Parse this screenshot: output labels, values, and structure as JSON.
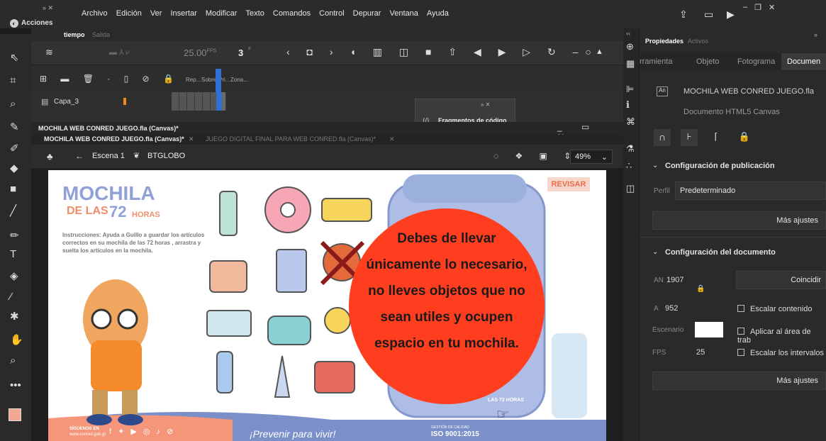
{
  "menubar": {
    "items": [
      "Archivo",
      "Edición",
      "Ver",
      "Insertar",
      "Modificar",
      "Texto",
      "Comandos",
      "Control",
      "Depurar",
      "Ventana",
      "Ayuda"
    ],
    "panel_label": "Acciones"
  },
  "timeline": {
    "tab_timeline": "tiempo",
    "tab_output": "Salida",
    "fps": "25.00",
    "fps_unit": "FPS",
    "frame": "3",
    "frame_unit": "F",
    "col_rep": "Rep...",
    "col_sobre": "Sobre",
    "col_pri": "Pri...",
    "col_zona": "Zona...",
    "layer_name": "Capa_3"
  },
  "snippets": {
    "label": "Fragmentos de código"
  },
  "document": {
    "title": "MOCHILA WEB CONRED JUEGO.fla (Canvas)*",
    "tab_active": "MOCHILA WEB CONRED JUEGO.fla (Canvas)*",
    "tab_other": "JUEGO DIGITAL FINAL PARA WEB CONRED.fla (Canvas)*",
    "scene": "Escena 1",
    "symbol": "BTGLOBO",
    "zoom": "49%"
  },
  "stage": {
    "logo_line1": "MOCHILA",
    "logo_line2": "DE LAS",
    "logo_num": "72",
    "logo_line3": "HORAS",
    "instructions": "Instrucciones: Ayuda a Guillo a guardar los artículos correctos en su mochila de las 72 horas , arrastra y suelta los artículos en la mochila.",
    "review_button": "REVISAR",
    "bubble_text": "Debes de llevar únicamente lo necesario, no lleves objetos que no sean utiles y ocupen espacio en tu mochila.",
    "footer_follow": "SÍGUENOS EN",
    "footer_site": "www.conred.gob.gt",
    "footer_slogan": "¡Prevenir para vivir!",
    "footer_iso": "ISO 9001:2015",
    "footer_quality": "GESTIÓN DE CALIDAD",
    "backpack_label": "LAS 72 HORAS",
    "colors": {
      "accent": "#ff3d1f",
      "footer": "#7b8fc9",
      "logo": "#8fa1d6"
    }
  },
  "properties": {
    "tab_properties": "Propiedades",
    "tab_assets": "Activos",
    "subtabs": [
      "rramienta",
      "Objeto",
      "Fotograma",
      "Documen"
    ],
    "file_name": "MOCHILA WEB CONRED JUEGO.fla",
    "file_type": "Documento HTML5 Canvas",
    "publish_section": "Configuración de publicación",
    "profile_label": "Perfil",
    "profile_value": "Predeterminado",
    "more_settings": "Más ajustes",
    "doc_section": "Configuración del documento",
    "width_label": "AN",
    "width_value": "1907",
    "height_label": "A",
    "height_value": "952",
    "match_button": "Coincidir",
    "scale_content": "Escalar contenido",
    "apply_area": "Aplicar al área de trab",
    "stage_label": "Escenario",
    "stage_color": "#ffffff",
    "fps_label": "FPS",
    "fps_value": "25",
    "scale_intervals": "Escalar los intervalos",
    "more_settings_2": "Más ajustes"
  }
}
